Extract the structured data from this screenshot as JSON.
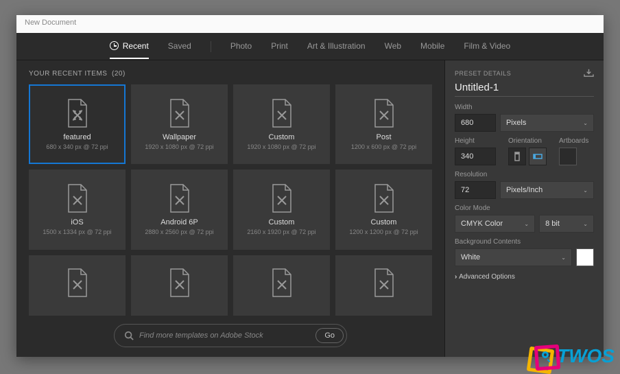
{
  "window": {
    "title": "New Document"
  },
  "tabs": {
    "recent": "Recent",
    "saved": "Saved",
    "photo": "Photo",
    "print": "Print",
    "art": "Art & Illustration",
    "web": "Web",
    "mobile": "Mobile",
    "film": "Film & Video"
  },
  "left": {
    "section_label": "YOUR RECENT ITEMS",
    "count": "(20)",
    "search_placeholder": "Find more templates on Adobe Stock",
    "go": "Go"
  },
  "cards": [
    {
      "title": "featured",
      "meta": "680 x 340 px @ 72 ppi"
    },
    {
      "title": "Wallpaper",
      "meta": "1920 x 1080 px @ 72 ppi"
    },
    {
      "title": "Custom",
      "meta": "1920 x 1080 px @ 72 ppi"
    },
    {
      "title": "Post",
      "meta": "1200 x 600 px @ 72 ppi"
    },
    {
      "title": "iOS",
      "meta": "1500 x 1334 px @ 72 ppi"
    },
    {
      "title": "Android 6P",
      "meta": "2880 x 2560 px @ 72 ppi"
    },
    {
      "title": "Custom",
      "meta": "2160 x 1920 px @ 72 ppi"
    },
    {
      "title": "Custom",
      "meta": "1200 x 1200 px @ 72 ppi"
    }
  ],
  "right": {
    "preset_details": "PRESET DETAILS",
    "doc_name": "Untitled-1",
    "width_label": "Width",
    "width_value": "680",
    "width_unit": "Pixels",
    "height_label": "Height",
    "height_value": "340",
    "orientation_label": "Orientation",
    "artboards_label": "Artboards",
    "resolution_label": "Resolution",
    "resolution_value": "72",
    "resolution_unit": "Pixels/Inch",
    "color_mode_label": "Color Mode",
    "color_mode": "CMYK Color",
    "bit_depth": "8 bit",
    "bg_label": "Background Contents",
    "bg_value": "White",
    "advanced": "Advanced Options"
  },
  "logo": {
    "text": "TWOS"
  }
}
